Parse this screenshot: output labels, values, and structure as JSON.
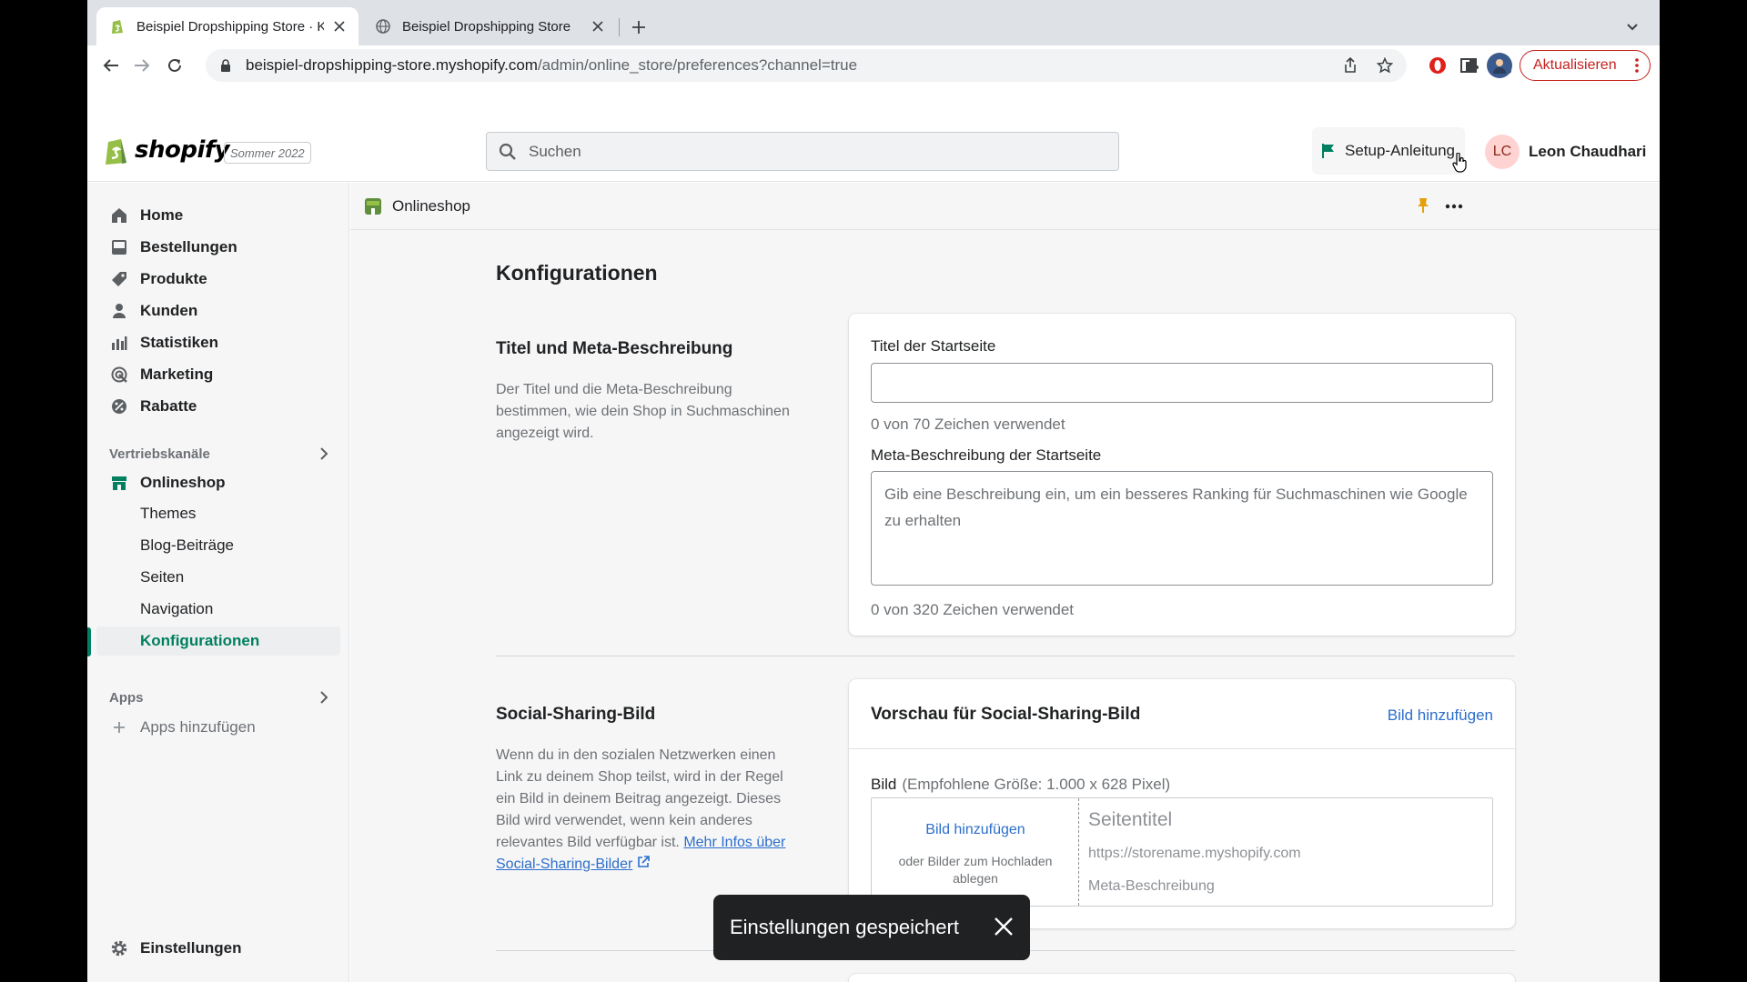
{
  "browser": {
    "tabs": [
      {
        "title": "Beispiel Dropshipping Store · K",
        "active": true
      },
      {
        "title": "Beispiel Dropshipping Store",
        "active": false
      }
    ],
    "url_host": "beispiel-dropshipping-store.myshopify.com",
    "url_path": "/admin/online_store/preferences?channel=true",
    "update_label": "Aktualisieren"
  },
  "topbar": {
    "logo_text": "shopify",
    "edition": "Sommer 2022",
    "search_placeholder": "Suchen",
    "setup_label": "Setup-Anleitung",
    "user_initials": "LC",
    "user_name": "Leon Chaudhari"
  },
  "sidebar": {
    "items": [
      {
        "label": "Home",
        "icon": "home-icon"
      },
      {
        "label": "Bestellungen",
        "icon": "orders-icon"
      },
      {
        "label": "Produkte",
        "icon": "tag-icon"
      },
      {
        "label": "Kunden",
        "icon": "person-icon"
      },
      {
        "label": "Statistiken",
        "icon": "analytics-icon"
      },
      {
        "label": "Marketing",
        "icon": "target-icon"
      },
      {
        "label": "Rabatte",
        "icon": "discount-icon"
      }
    ],
    "sales_channels_label": "Vertriebskanäle",
    "online_store_label": "Onlineshop",
    "sub_items": [
      {
        "label": "Themes"
      },
      {
        "label": "Blog-Beiträge"
      },
      {
        "label": "Seiten"
      },
      {
        "label": "Navigation"
      },
      {
        "label": "Konfigurationen",
        "active": true
      }
    ],
    "apps_label": "Apps",
    "add_apps_label": "Apps hinzufügen",
    "settings_label": "Einstellungen"
  },
  "page": {
    "breadcrumb": "Onlineshop",
    "title": "Konfigurationen",
    "meta_section": {
      "title": "Titel und Meta-Beschreibung",
      "description": "Der Titel und die Meta-Beschreibung bestimmen, wie dein Shop in Suchmaschinen angezeigt wird.",
      "home_title_label": "Titel der Startseite",
      "home_title_value": "",
      "home_title_count": "0 von 70 Zeichen verwendet",
      "meta_desc_label": "Meta-Beschreibung der Startseite",
      "meta_desc_placeholder": "Gib eine Beschreibung ein, um ein besseres Ranking für Suchmaschinen wie Google zu erhalten",
      "meta_desc_count": "0 von 320 Zeichen verwendet"
    },
    "social_section": {
      "title": "Social-Sharing-Bild",
      "description": "Wenn du in den sozialen Netzwerken einen Link zu deinem Shop teilst, wird in der Regel ein Bild in deinem Beitrag angezeigt. Dieses Bild wird verwendet, wenn kein anderes relevantes Bild verfügbar ist.",
      "more_link": "Mehr Infos über Social-Sharing-Bilder",
      "card_title": "Vorschau für Social-Sharing-Bild",
      "add_image_link": "Bild hinzufügen",
      "image_label": "Bild",
      "image_hint": "(Empfohlene Größe: 1.000 x 628 Pixel)",
      "dropzone_link": "Bild hinzufügen",
      "dropzone_text": "oder Bilder zum Hochladen ablegen",
      "preview_title": "Seitentitel",
      "preview_url": "https://storename.myshopify.com",
      "preview_desc": "Meta-Beschreibung"
    }
  },
  "toast": {
    "message": "Einstellungen gespeichert"
  },
  "colors": {
    "accent": "#008060",
    "link": "#2c6ecb",
    "toast_bg": "#202123"
  }
}
